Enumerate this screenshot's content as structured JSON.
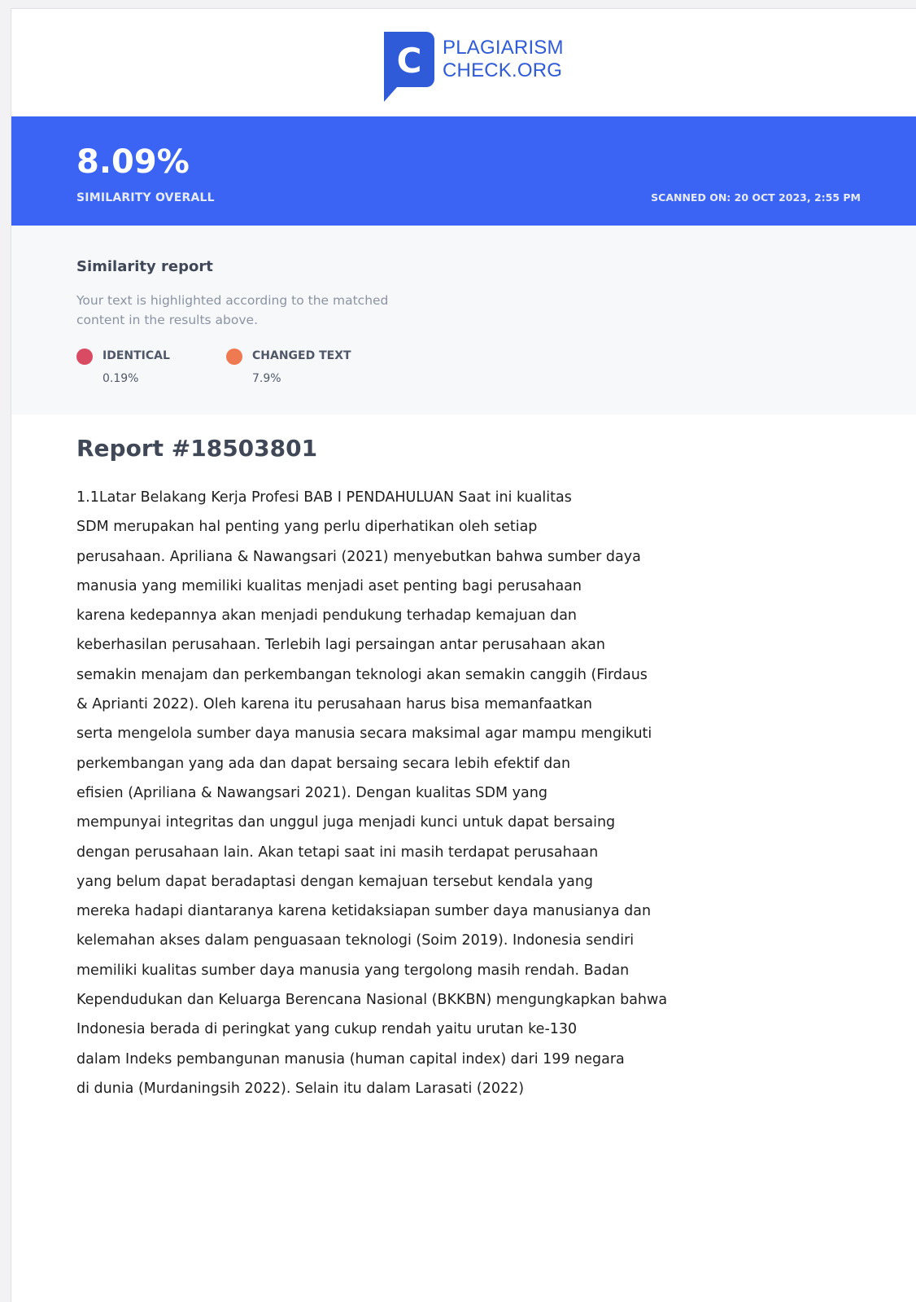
{
  "logo": {
    "line1": "PLAGIARISM",
    "line2": "CHECK.ORG",
    "mark_letter": "C",
    "brand_color": "#2f5bd9"
  },
  "banner": {
    "score": "8.09%",
    "score_label": "SIMILARITY OVERALL",
    "scanned_on": "SCANNED ON: 20 OCT 2023, 2:55 PM",
    "color": "#3b64f5"
  },
  "similarity": {
    "title": "Similarity report",
    "description": "Your text is highlighted according to the matched content in the results above.",
    "legend": [
      {
        "label": "IDENTICAL",
        "value": "0.19%",
        "color": "#d94b63"
      },
      {
        "label": "CHANGED TEXT",
        "value": "7.9%",
        "color": "#ef7a52"
      }
    ]
  },
  "report": {
    "title": "Report #18503801",
    "lines": [
      "1.1Latar Belakang Kerja Profesi BAB I PENDAHULUAN Saat ini kualitas",
      "SDM merupakan hal penting yang perlu diperhatikan oleh setiap",
      "perusahaan. Apriliana & Nawangsari (2021) menyebutkan bahwa sumber daya",
      "manusia yang memiliki kualitas menjadi aset penting bagi perusahaan",
      "karena kedepannya akan menjadi pendukung terhadap kemajuan dan",
      "keberhasilan perusahaan. Terlebih lagi persaingan antar perusahaan akan",
      "semakin menajam dan perkembangan teknologi akan semakin canggih (Firdaus",
      "& Aprianti 2022). Oleh karena itu perusahaan harus bisa memanfaatkan",
      "serta mengelola sumber daya manusia secara maksimal agar mampu mengikuti",
      "perkembangan yang ada dan dapat bersaing secara lebih efektif dan",
      "efisien (Apriliana & Nawangsari 2021). Dengan kualitas SDM yang",
      "mempunyai integritas dan unggul juga menjadi kunci untuk dapat bersaing",
      "dengan perusahaan lain. Akan tetapi saat ini masih terdapat perusahaan",
      "yang belum dapat beradaptasi dengan kemajuan tersebut kendala yang",
      "mereka hadapi diantaranya karena ketidaksiapan sumber daya manusianya dan",
      "kelemahan akses dalam penguasaan teknologi (Soim 2019). Indonesia sendiri",
      "memiliki kualitas sumber daya manusia yang tergolong masih rendah. Badan",
      "Kependudukan dan Keluarga Berencana Nasional (BKKBN) mengungkapkan bahwa",
      "Indonesia berada di peringkat yang cukup rendah yaitu urutan ke-130",
      "dalam Indeks pembangunan manusia (human capital index) dari 199 negara",
      "di dunia (Murdaningsih 2022). Selain itu dalam Larasati (2022)"
    ]
  }
}
